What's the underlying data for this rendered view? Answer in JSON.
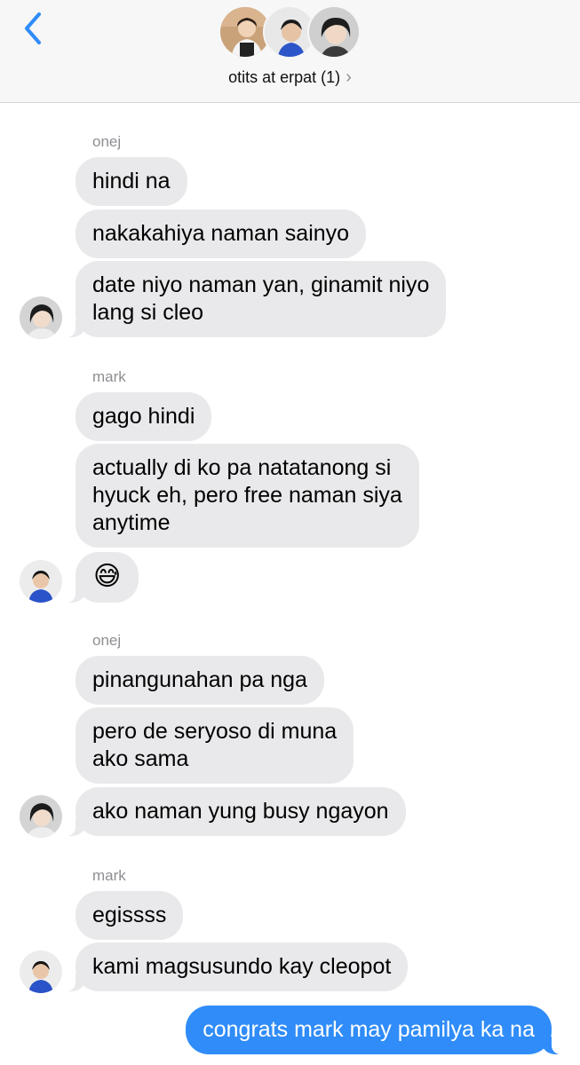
{
  "header": {
    "group_title": "otits at erpat (1)",
    "chevron_glyph": "›",
    "back_icon": "chevron-left-icon",
    "accent_color": "#2f8cf8"
  },
  "messages": {
    "sender_1": "onej",
    "m1": "hindi na",
    "m2": "nakakahiya naman sainyo",
    "m3_l1": "date niyo naman yan, ginamit niyo",
    "m3_l2": "lang si cleo",
    "sender_2": "mark",
    "m4": "gago hindi",
    "m5_l1": "actually di ko pa natatanong si",
    "m5_l2": "hyuck eh, pero free naman siya",
    "m5_l3": "anytime",
    "m6": "😅",
    "sender_3": "onej",
    "m7": "pinangunahan pa nga",
    "m8_l1": "pero de seryoso di muna",
    "m8_l2": "ako sama",
    "m9": "ako naman yung busy ngayon",
    "sender_4": "mark",
    "m10": "egissss",
    "m11": "kami magsusundo kay cleopot",
    "m12": "congrats mark may pamilya ka na"
  },
  "colors": {
    "incoming_bubble": "#e9e9eb",
    "outgoing_bubble": "#2f8cf8",
    "sender_label": "#8e8e93"
  }
}
